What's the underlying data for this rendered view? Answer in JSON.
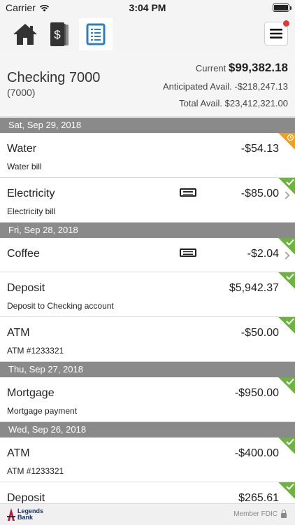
{
  "status_bar": {
    "carrier": "Carrier",
    "time": "3:04 PM"
  },
  "tabs": [
    {
      "name": "home",
      "icon": "home-icon",
      "active": false
    },
    {
      "name": "transfers",
      "icon": "money-icon",
      "active": false
    },
    {
      "name": "accounts",
      "icon": "ledger-icon",
      "active": true
    }
  ],
  "menu": {
    "icon": "hamburger-menu-icon",
    "has_notification": true
  },
  "account": {
    "name": "Checking 7000",
    "number": "(7000)",
    "current_label": "Current",
    "current_value": "$99,382.18",
    "anticipated": "Anticipated Avail. -$218,247.13",
    "total": "Total Avail. $23,412,321.00"
  },
  "days": [
    {
      "date": "Sat, Sep 29, 2018",
      "transactions": [
        {
          "title": "Water",
          "amount": "-$54.13",
          "description": "Water bill",
          "memo": false,
          "status": "pending",
          "chevron": false
        },
        {
          "title": "Electricity",
          "amount": "-$85.00",
          "description": "Electricity bill",
          "memo": true,
          "status": "cleared",
          "chevron": true
        }
      ]
    },
    {
      "date": "Fri, Sep 28, 2018",
      "transactions": [
        {
          "title": "Coffee",
          "amount": "-$2.04",
          "description": "",
          "memo": true,
          "status": "cleared",
          "chevron": true
        },
        {
          "title": "Deposit",
          "amount": "$5,942.37",
          "description": "Deposit to Checking account",
          "memo": false,
          "status": "cleared",
          "chevron": false
        },
        {
          "title": "ATM",
          "amount": "-$50.00",
          "description": "ATM #1233321",
          "memo": false,
          "status": "cleared",
          "chevron": false
        }
      ]
    },
    {
      "date": "Thu, Sep 27, 2018",
      "transactions": [
        {
          "title": "Mortgage",
          "amount": "-$950.00",
          "description": "Mortgage payment",
          "memo": false,
          "status": "cleared",
          "chevron": false
        }
      ]
    },
    {
      "date": "Wed, Sep 26, 2018",
      "transactions": [
        {
          "title": "ATM",
          "amount": "-$400.00",
          "description": "ATM #1233321",
          "memo": false,
          "status": "cleared",
          "chevron": false
        },
        {
          "title": "Deposit",
          "amount": "$265.61",
          "description": "",
          "memo": false,
          "status": "cleared",
          "chevron": false
        }
      ]
    }
  ],
  "footer": {
    "logo_line1": "Legends",
    "logo_line2": "Bank",
    "fdic": "Member FDIC"
  },
  "colors": {
    "accent": "#2b7fc2",
    "cleared": "#6db33f",
    "pending": "#f0a020",
    "day_header": "#8a8a8a"
  }
}
